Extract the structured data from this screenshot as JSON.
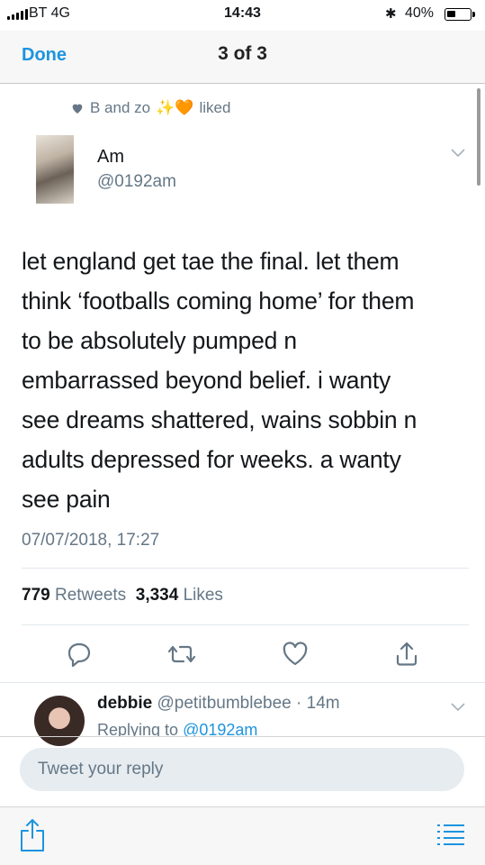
{
  "status_bar": {
    "carrier": "BT  4G",
    "time": "14:43",
    "bluetooth": "bluetooth-icon",
    "battery_percent": "40%",
    "battery_level": 0.4
  },
  "nav": {
    "done_label": "Done",
    "title": "3 of 3"
  },
  "social_context": {
    "users": "B and zo",
    "emoji": "✨🧡",
    "action": "liked"
  },
  "tweet": {
    "author_name": "Am",
    "author_handle": "@0192am",
    "lines": [
      "let england get tae the final. let them",
      "think ‘footballs coming home’ for them",
      "to be absolutely pumped n",
      "embarrassed beyond belief. i wanty",
      "see dreams shattered, wains sobbin n",
      "adults depressed for weeks. a wanty",
      "see pain"
    ],
    "timestamp": "07/07/2018, 17:27",
    "retweets_count": "779",
    "retweets_label": "Retweets",
    "likes_count": "3,334",
    "likes_label": "Likes"
  },
  "actions": [
    "reply-icon",
    "retweet-icon",
    "like-icon",
    "share-icon"
  ],
  "reply": {
    "name": "debbie",
    "handle": "@petitbumblebee",
    "separator": "·",
    "age": "14m",
    "replying_to_label": "Replying to",
    "replying_to_handle": "@0192am"
  },
  "composer": {
    "placeholder": "Tweet your reply"
  },
  "toolbar": [
    "share-icon",
    "menu-icon"
  ],
  "colors": {
    "accent": "#1c94e0",
    "secondary_text": "#657786",
    "heart": "#f4900c"
  }
}
